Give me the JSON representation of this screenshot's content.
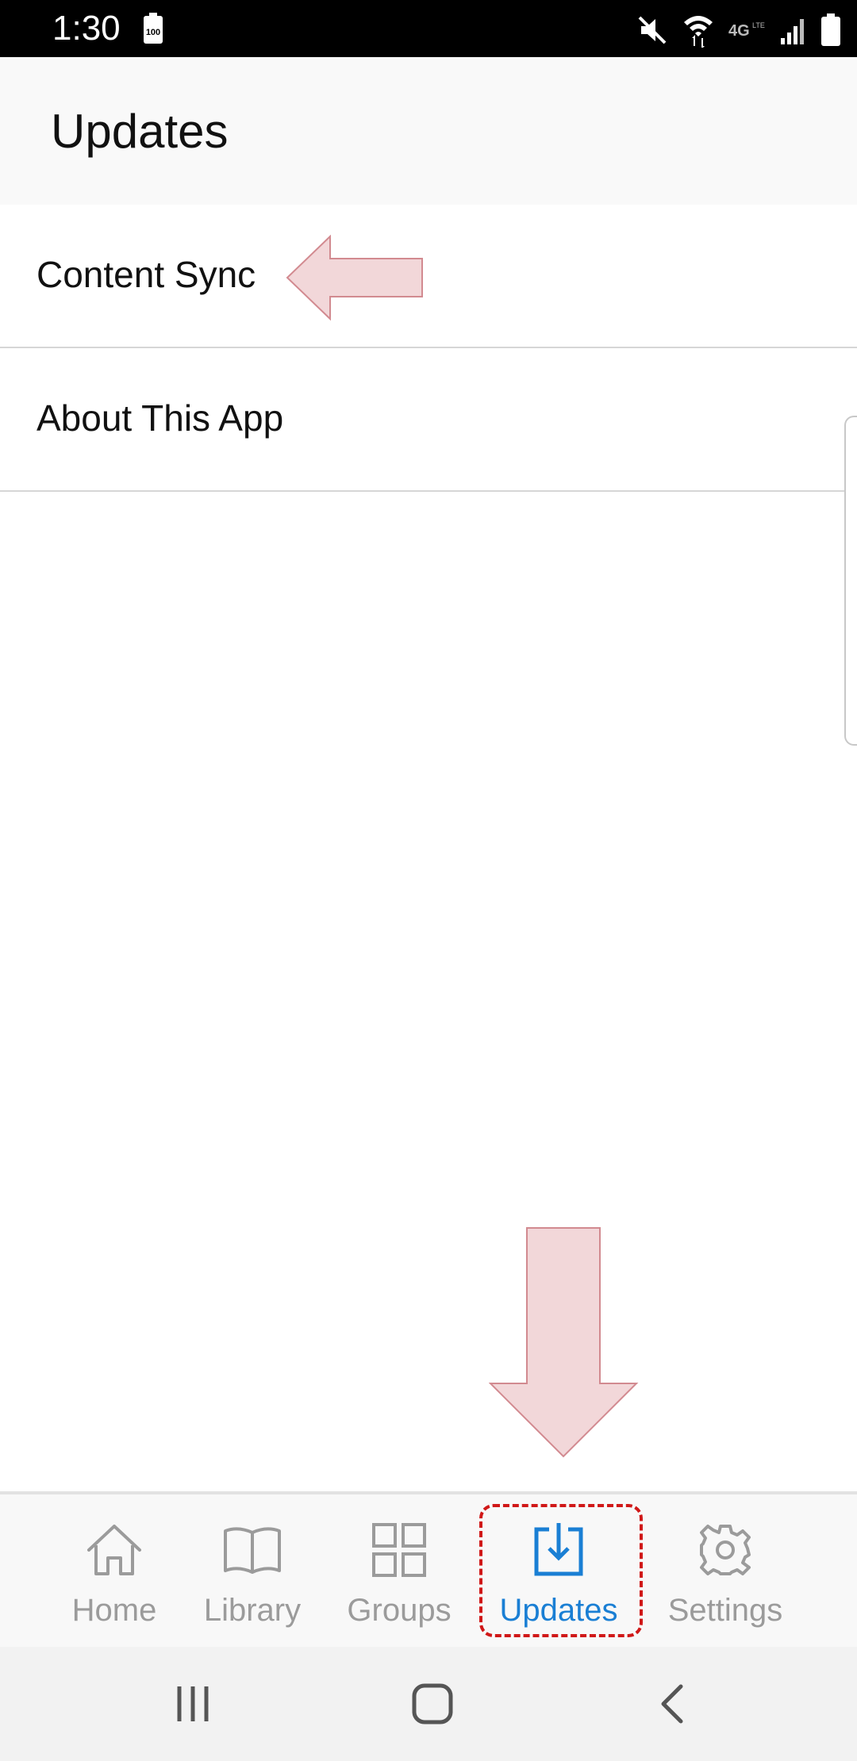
{
  "status_bar": {
    "time": "1:30",
    "battery_badge": "100",
    "icons": [
      "battery-saver-icon",
      "mute-icon",
      "wifi-icon",
      "4g-lte-icon",
      "signal-icon",
      "battery-icon"
    ]
  },
  "header": {
    "title": "Updates"
  },
  "list": {
    "items": [
      {
        "label": "Content Sync"
      },
      {
        "label": "About This App"
      }
    ]
  },
  "tab_bar": {
    "active_tab": "Updates",
    "active_color": "#1a7fd4",
    "inactive_color": "#9b9b9b",
    "tabs": [
      {
        "label": "Home",
        "icon": "home-icon"
      },
      {
        "label": "Library",
        "icon": "book-icon"
      },
      {
        "label": "Groups",
        "icon": "grid-icon"
      },
      {
        "label": "Updates",
        "icon": "download-icon"
      },
      {
        "label": "Settings",
        "icon": "gear-icon"
      }
    ]
  },
  "annotations": {
    "arrow_color": "#f2d7d9",
    "arrow_stroke": "#d28a90",
    "highlight_color": "#d01818"
  },
  "nav_bar": {
    "buttons": [
      "recent-apps-icon",
      "home-button-icon",
      "back-icon"
    ]
  }
}
